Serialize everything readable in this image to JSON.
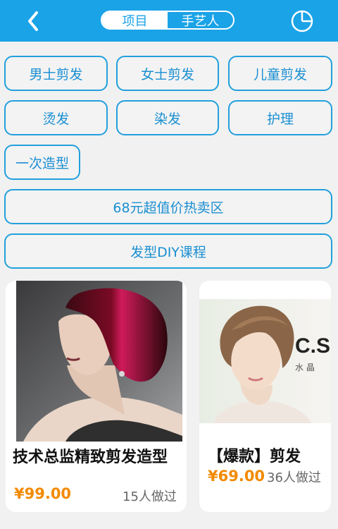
{
  "header": {
    "tabs": [
      {
        "label": "项目",
        "active": true
      },
      {
        "label": "手艺人",
        "active": false
      }
    ]
  },
  "categories": [
    "男士剪发",
    "女士剪发",
    "儿童剪发",
    "烫发",
    "染发",
    "护理",
    "一次造型"
  ],
  "promos": [
    "68元超值价热卖区",
    "发型DIY课程"
  ],
  "products": [
    {
      "title": "技术总监精致剪发造型",
      "price": "¥99.00",
      "sold": "15人做过",
      "image": "portrait-red-bob"
    },
    {
      "title": "【爆款】剪发",
      "price": "¥69.00",
      "sold": "36人做过",
      "image": "portrait-short-hair"
    }
  ],
  "colors": {
    "accent": "#1aa3e7",
    "price": "#f28a00"
  },
  "watermark": {
    "text": "C.S",
    "sub": "水 晶"
  }
}
